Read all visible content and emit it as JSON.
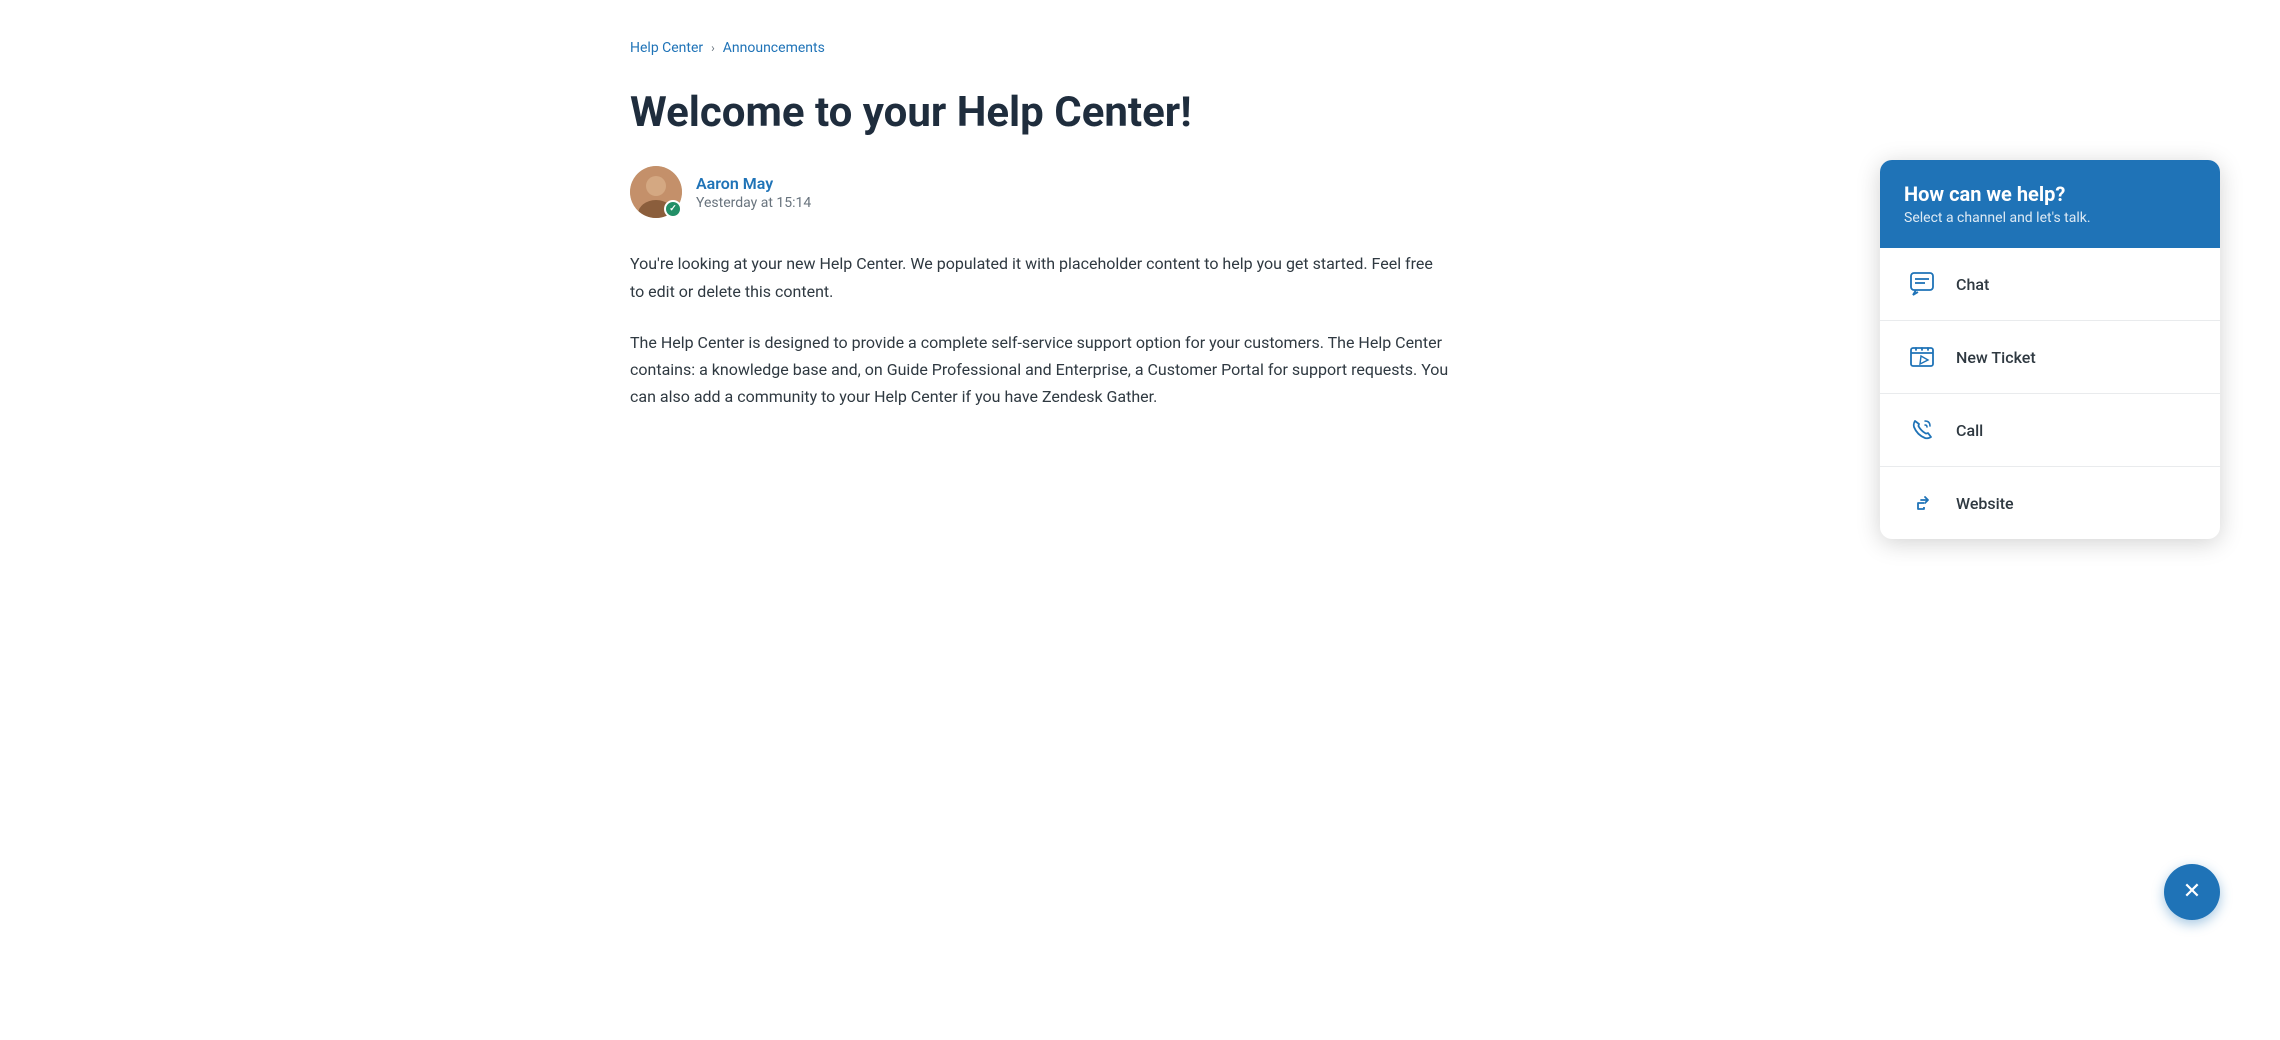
{
  "breadcrumb": {
    "home_label": "Help Center",
    "separator": "›",
    "current_label": "Announcements"
  },
  "article": {
    "title": "Welcome to your Help Center!",
    "author_name": "Aaron May",
    "author_date": "Yesterday at 15:14",
    "paragraph1": "You're looking at your new Help Center. We populated it with placeholder content to help you get started. Feel free to edit or delete this content.",
    "paragraph2": "The Help Center is designed to provide a complete self-service support option for your customers. The Help Center contains: a knowledge base and, on Guide Professional and Enterprise, a Customer Portal for support requests. You can also add a community to your Help Center if you have Zendesk Gather."
  },
  "widget": {
    "header_title": "How can we help?",
    "header_subtitle": "Select a channel and let's talk.",
    "options": [
      {
        "id": "chat",
        "label": "Chat",
        "icon": "chat-icon"
      },
      {
        "id": "new-ticket",
        "label": "New Ticket",
        "icon": "ticket-icon"
      },
      {
        "id": "call",
        "label": "Call",
        "icon": "call-icon"
      },
      {
        "id": "website",
        "label": "Website",
        "icon": "website-icon"
      }
    ]
  },
  "close_button_aria": "Close widget"
}
